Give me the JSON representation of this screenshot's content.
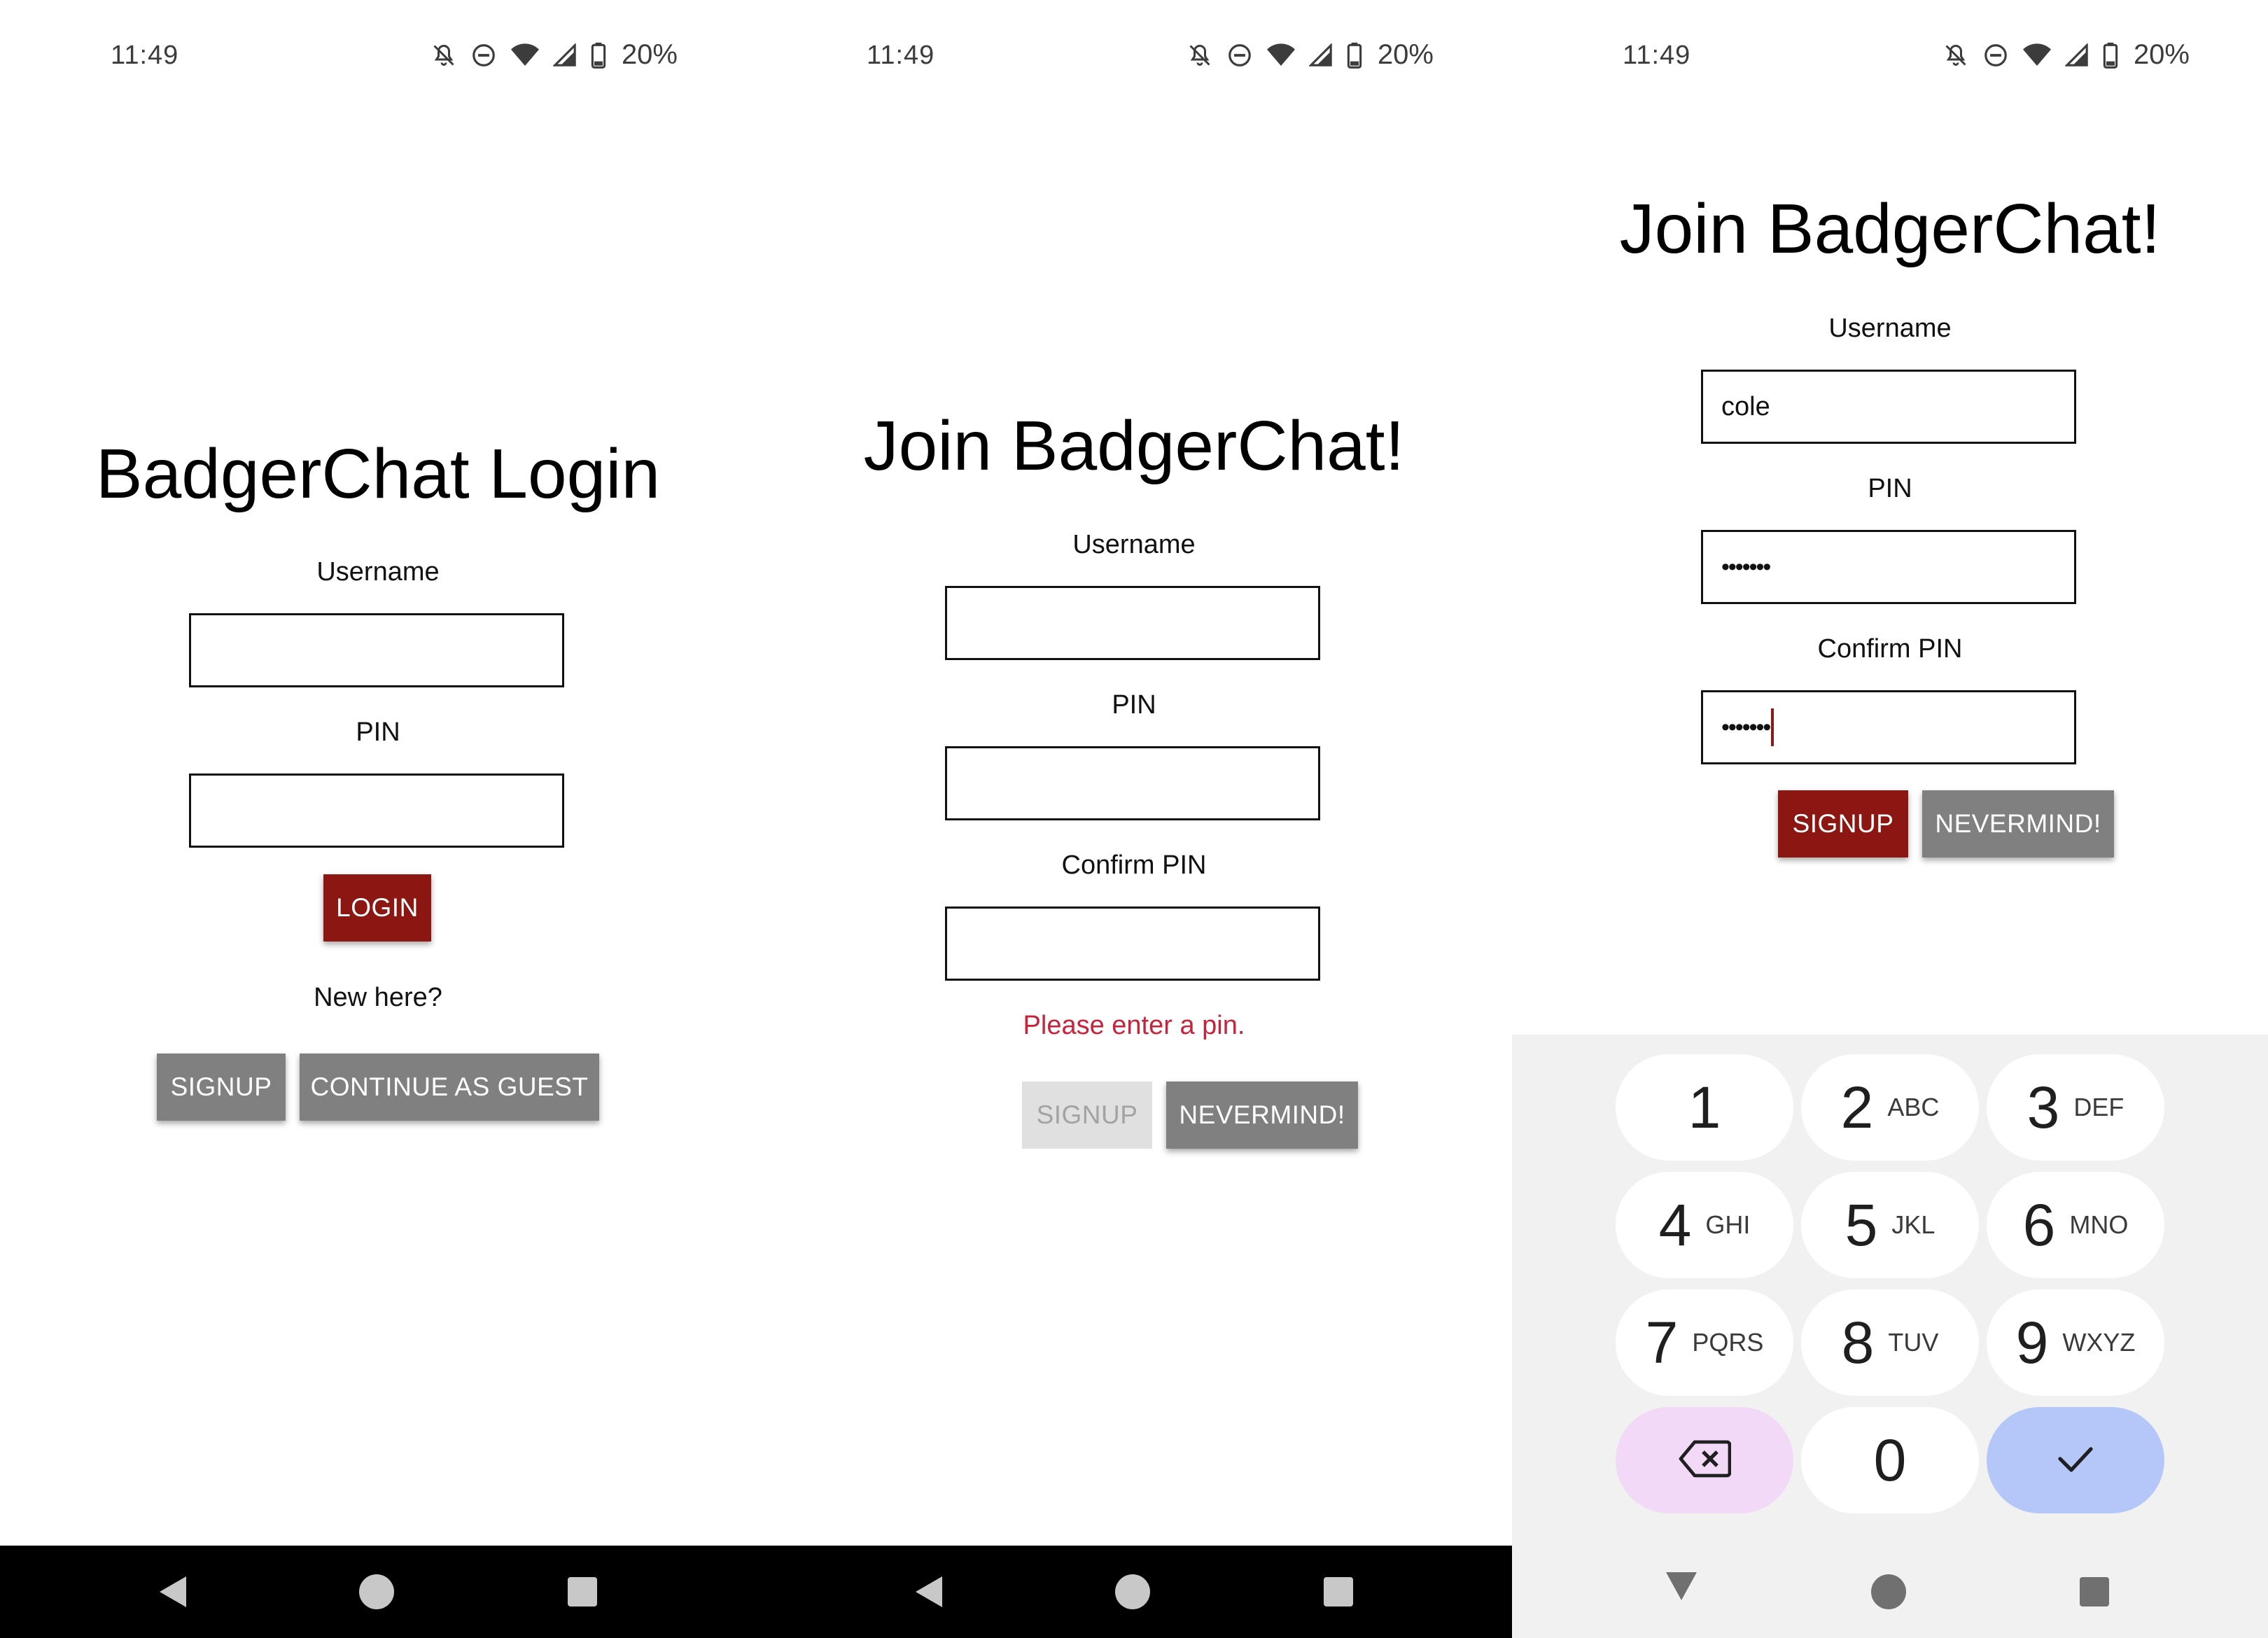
{
  "status": {
    "time": "11:49",
    "battery": "20%",
    "icons": [
      "bell-off-icon",
      "do-not-disturb-icon",
      "wifi-icon",
      "signal-icon",
      "battery-icon"
    ]
  },
  "screen1": {
    "title": "BadgerChat Login",
    "username_label": "Username",
    "pin_label": "PIN",
    "login_button": "LOGIN",
    "new_here": "New here?",
    "signup_button": "SIGNUP",
    "guest_button": "CONTINUE AS GUEST"
  },
  "screen2": {
    "title": "Join BadgerChat!",
    "username_label": "Username",
    "pin_label": "PIN",
    "confirm_label": "Confirm PIN",
    "error": "Please enter a pin.",
    "signup_button": "SIGNUP",
    "nevermind_button": "NEVERMIND!"
  },
  "screen3": {
    "title": "Join BadgerChat!",
    "username_label": "Username",
    "username_value": "cole",
    "pin_label": "PIN",
    "pin_value": "•••••••",
    "confirm_label": "Confirm PIN",
    "confirm_value": "•••••••",
    "signup_button": "SIGNUP",
    "nevermind_button": "NEVERMIND!"
  },
  "keypad": {
    "keys": [
      {
        "num": "1",
        "sub": ""
      },
      {
        "num": "2",
        "sub": "ABC"
      },
      {
        "num": "3",
        "sub": "DEF"
      },
      {
        "num": "4",
        "sub": "GHI"
      },
      {
        "num": "5",
        "sub": "JKL"
      },
      {
        "num": "6",
        "sub": "MNO"
      },
      {
        "num": "7",
        "sub": "PQRS"
      },
      {
        "num": "8",
        "sub": "TUV"
      },
      {
        "num": "9",
        "sub": "WXYZ"
      },
      {
        "num": "0",
        "sub": ""
      }
    ],
    "delete_icon": "backspace-icon",
    "done_icon": "check-icon"
  },
  "colors": {
    "primary": "#8b1612",
    "secondary": "#808080",
    "error": "#c8233a",
    "disabled_bg": "#e0e0e0",
    "delete_key": "#f2d9f7",
    "done_key": "#b5c7f8"
  }
}
